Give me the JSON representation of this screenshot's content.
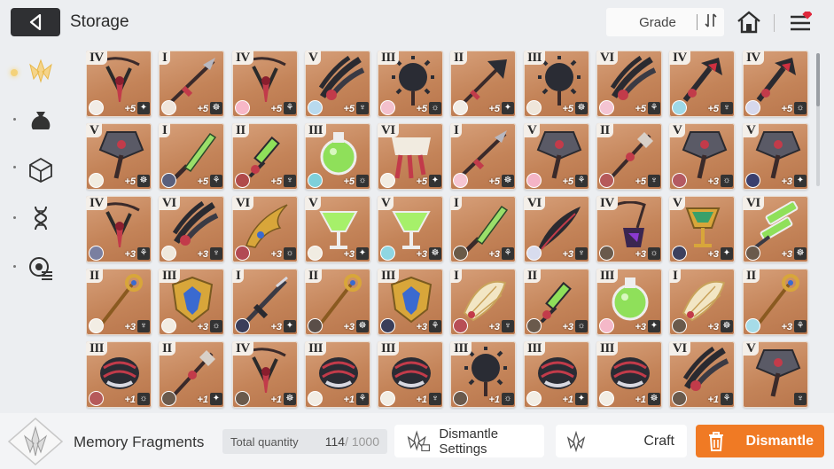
{
  "header": {
    "title": "Storage",
    "sort_label": "Grade",
    "sort_icon": "sort-toggle-icon",
    "home_icon": "home-icon",
    "menu_icon": "menu-icon",
    "menu_badge_color": "#e0283c"
  },
  "sidebar": {
    "items": [
      {
        "name": "weapon-category",
        "icon": "crest-icon",
        "active": true
      },
      {
        "name": "materials-category",
        "icon": "bag-icon",
        "active": false
      },
      {
        "name": "items-category",
        "icon": "cube-icon",
        "active": false
      },
      {
        "name": "genes-category",
        "icon": "dna-icon",
        "active": false
      },
      {
        "name": "modules-category",
        "icon": "chip-icon",
        "active": false
      }
    ]
  },
  "grid": {
    "rows": [
      [
        {
          "grade": "IV",
          "level": "+5",
          "weapon": "chain",
          "avatar": "#f1ece6"
        },
        {
          "grade": "I",
          "level": "+5",
          "weapon": "spear",
          "avatar": "#f0e6dc"
        },
        {
          "grade": "IV",
          "level": "+5",
          "weapon": "chain",
          "avatar": "#f7b7c7"
        },
        {
          "grade": "V",
          "level": "+5",
          "weapon": "claw",
          "avatar": "#b8d9ee"
        },
        {
          "grade": "III",
          "level": "+5",
          "weapon": "mace",
          "avatar": "#f3c0cc"
        },
        {
          "grade": "II",
          "level": "+5",
          "weapon": "axe",
          "avatar": "#f2ede6"
        },
        {
          "grade": "III",
          "level": "+5",
          "weapon": "mace",
          "avatar": "#efe6da"
        },
        {
          "grade": "VI",
          "level": "+5",
          "weapon": "claw",
          "avatar": "#f4c4d2"
        },
        {
          "grade": "IV",
          "level": "+5",
          "weapon": "claw-red",
          "avatar": "#9ed8e6"
        },
        {
          "grade": "IV",
          "level": "+5",
          "weapon": "claw-red",
          "avatar": "#d6d8ec"
        }
      ],
      [
        {
          "grade": "V",
          "level": "+5",
          "weapon": "hammer",
          "avatar": "#f1ece0"
        },
        {
          "grade": "I",
          "level": "+5",
          "weapon": "knife",
          "avatar": "#5a5f7c"
        },
        {
          "grade": "II",
          "level": "+5",
          "weapon": "syringe",
          "avatar": "#b04a4a"
        },
        {
          "grade": "III",
          "level": "+5",
          "weapon": "flask",
          "avatar": "#7ed0da"
        },
        {
          "grade": "VI",
          "level": "+5",
          "weapon": "scroll",
          "avatar": "#f2ece2"
        },
        {
          "grade": "I",
          "level": "+5",
          "weapon": "spear",
          "avatar": "#f6c6d2"
        },
        {
          "grade": "V",
          "level": "+5",
          "weapon": "hammer",
          "avatar": "#f4b4c6"
        },
        {
          "grade": "II",
          "level": "+5",
          "weapon": "staff",
          "avatar": "#b65a5a"
        },
        {
          "grade": "V",
          "level": "+3",
          "weapon": "hammer",
          "avatar": "#b45a62"
        },
        {
          "grade": "V",
          "level": "+3",
          "weapon": "hammer",
          "avatar": "#3a3f6e"
        }
      ],
      [
        {
          "grade": "IV",
          "level": "+3",
          "weapon": "chain",
          "avatar": "#7a7fa0"
        },
        {
          "grade": "VI",
          "level": "+3",
          "weapon": "claw",
          "avatar": "#efe8dc"
        },
        {
          "grade": "VI",
          "level": "+3",
          "weapon": "wing-gold",
          "avatar": "#b24a54"
        },
        {
          "grade": "V",
          "level": "+3",
          "weapon": "goblet",
          "avatar": "#f1ece2"
        },
        {
          "grade": "V",
          "level": "+3",
          "weapon": "goblet",
          "avatar": "#8fd6e2"
        },
        {
          "grade": "I",
          "level": "+3",
          "weapon": "knife",
          "avatar": "#6a5a48"
        },
        {
          "grade": "VI",
          "level": "+3",
          "weapon": "feather",
          "avatar": "#d8dcee"
        },
        {
          "grade": "IV",
          "level": "+3",
          "weapon": "chain-dark",
          "avatar": "#6a5a4c"
        },
        {
          "grade": "V",
          "level": "+3",
          "weapon": "chalice",
          "avatar": "#3c405e"
        },
        {
          "grade": "VI",
          "level": "+3",
          "weapon": "injector",
          "avatar": "#6a5a4c"
        }
      ],
      [
        {
          "grade": "II",
          "level": "+3",
          "weapon": "staff-gold",
          "avatar": "#f2ede4"
        },
        {
          "grade": "III",
          "level": "+3",
          "weapon": "crest",
          "avatar": "#f2ece2"
        },
        {
          "grade": "I",
          "level": "+3",
          "weapon": "sword",
          "avatar": "#3a3e5a"
        },
        {
          "grade": "II",
          "level": "+3",
          "weapon": "staff-gold",
          "avatar": "#5a4e48"
        },
        {
          "grade": "III",
          "level": "+3",
          "weapon": "crest",
          "avatar": "#3a3e5a"
        },
        {
          "grade": "I",
          "level": "+3",
          "weapon": "fan",
          "avatar": "#b84e56"
        },
        {
          "grade": "II",
          "level": "+3",
          "weapon": "syringe",
          "avatar": "#6a5a4c"
        },
        {
          "grade": "III",
          "level": "+3",
          "weapon": "flask",
          "avatar": "#f4b8c8"
        },
        {
          "grade": "I",
          "level": "+3",
          "weapon": "fan",
          "avatar": "#6a5a4c"
        },
        {
          "grade": "II",
          "level": "+3",
          "weapon": "staff-gold",
          "avatar": "#a6dce8"
        }
      ],
      [
        {
          "grade": "III",
          "level": "+1",
          "weapon": "gauntlet",
          "avatar": "#b65a5a"
        },
        {
          "grade": "II",
          "level": "+1",
          "weapon": "staff",
          "avatar": "#6a5a4c"
        },
        {
          "grade": "IV",
          "level": "+1",
          "weapon": "chain",
          "avatar": "#6a5a4c"
        },
        {
          "grade": "III",
          "level": "+1",
          "weapon": "gauntlet",
          "avatar": "#f2ede4"
        },
        {
          "grade": "III",
          "level": "+1",
          "weapon": "gauntlet",
          "avatar": "#f2ede4"
        },
        {
          "grade": "III",
          "level": "+1",
          "weapon": "mace",
          "avatar": "#6a5a4c"
        },
        {
          "grade": "III",
          "level": "+1",
          "weapon": "gauntlet",
          "avatar": "#f2ede4"
        },
        {
          "grade": "III",
          "level": "+1",
          "weapon": "gauntlet",
          "avatar": "#f2ede4"
        },
        {
          "grade": "VI",
          "level": "+1",
          "weapon": "claw",
          "avatar": "#6a5a4c"
        },
        {
          "grade": "V",
          "level": "",
          "weapon": "hammer",
          "avatar": ""
        }
      ]
    ]
  },
  "footer": {
    "fragment_label": "Memory Fragments",
    "quantity_label": "Total quantity",
    "quantity_value": "114",
    "quantity_max": " / 1000",
    "settings_label": "Dismantle Settings",
    "craft_label": "Craft",
    "dismantle_label": "Dismantle",
    "accent_color": "#f07a24"
  }
}
